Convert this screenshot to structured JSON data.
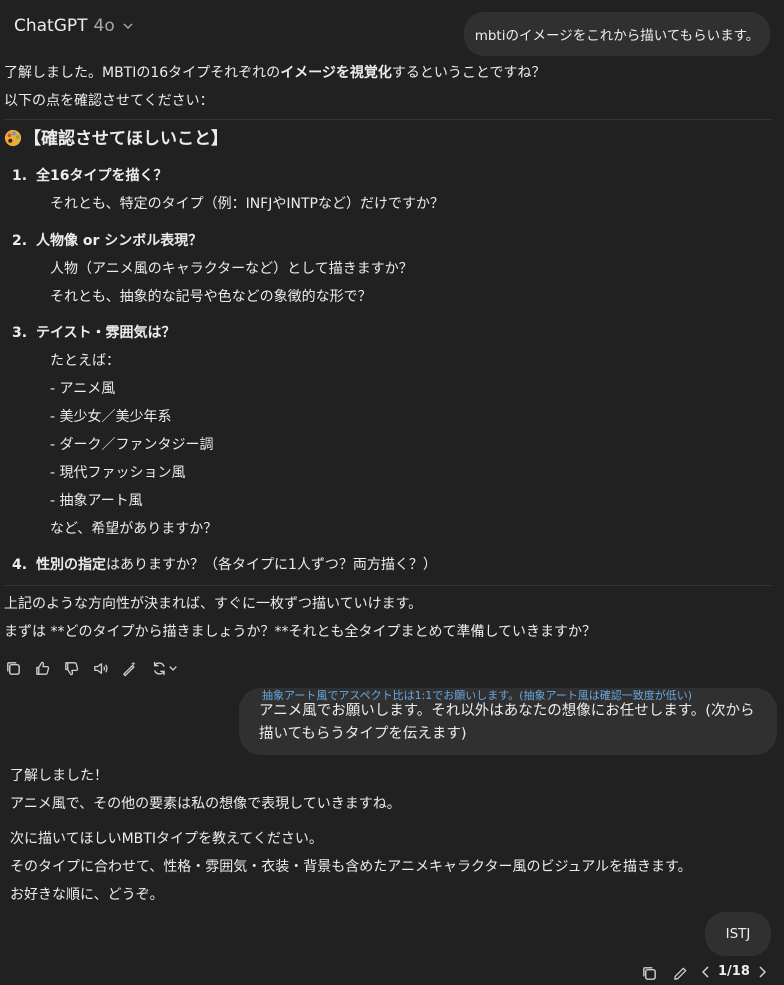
{
  "header": {
    "title": "ChatGPT",
    "model": "4o"
  },
  "user_msg1": "mbtiのイメージをこれから描いてもらいます。",
  "assistant1": {
    "intro_a": "了解しました。MBTIの16タイプそれぞれの",
    "intro_bold": "イメージを視覚化",
    "intro_b": "するということですね？",
    "intro2": "以下の点を確認させてください：",
    "heading": "【確認させてほしいこと】",
    "items": [
      {
        "num": "1.",
        "title": "全16タイプを描く？",
        "lines": [
          "それとも、特定のタイプ（例：INFJやINTPなど）だけですか？"
        ]
      },
      {
        "num": "2.",
        "title": "人物像 or シンボル表現？",
        "lines": [
          "人物（アニメ風のキャラクターなど）として描きますか？",
          "それとも、抽象的な記号や色などの象徴的な形で？"
        ]
      },
      {
        "num": "3.",
        "title": "テイスト・雰囲気は？",
        "lines": [
          "たとえば：",
          "- アニメ風",
          "- 美少女／美少年系",
          "- ダーク／ファンタジー調",
          "- 現代ファッション風",
          "- 抽象アート風",
          "など、希望がありますか？"
        ]
      },
      {
        "num": "4.",
        "title": "性別の指定",
        "title_rest": "はありますか？（各タイプに1人ずつ？両方描く？）",
        "lines": []
      }
    ],
    "outro1": "上記のような方向性が決まれば、すぐに一枚ずつ描いていけます。",
    "outro2": "まずは **どのタイプから描きましょうか？**それとも全タイプまとめて準備していきますか？"
  },
  "user_msg2": {
    "note": "抽象アート風でアスペクト比は1:1でお願いします。(抽象アート風は確認一致度が低い)",
    "text": "アニメ風でお願いします。それ以外はあなたの想像にお任せします。(次から描いてもらうタイプを伝えます)"
  },
  "assistant2": {
    "l1": "了解しました！",
    "l2": "アニメ風で、その他の要素は私の想像で表現していきますね。",
    "l3": "次に描いてほしいMBTIタイプを教えてください。",
    "l4": "そのタイプに合わせて、性格・雰囲気・衣装・背景も含めたアニメキャラクター風のビジュアルを描きます。",
    "l5": "お好きな順に、どうぞ。"
  },
  "user_msg3": "ISTJ",
  "pager": "1/18",
  "icons": [
    "copy-icon",
    "thumbs-up-icon",
    "thumbs-down-icon",
    "speaker-icon",
    "edit-sparkle-icon",
    "regenerate-icon",
    "edit-icon",
    "chevron-left-icon",
    "chevron-right-icon"
  ]
}
